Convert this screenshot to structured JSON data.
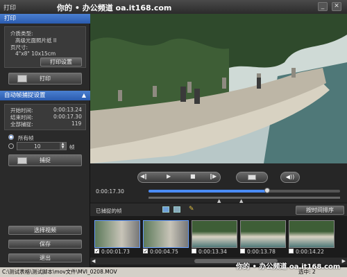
{
  "window": {
    "title": "打印",
    "watermark_top": "你的 • 办公频道 oa.it168.com"
  },
  "print_section": {
    "header": "打印",
    "media_type_label": "介质类型:",
    "media_type_value": "高级光面照片纸 II",
    "page_size_label": "页尺寸:",
    "page_size_value": "4\"x8\" 10x15cm",
    "settings_button": "打印设置",
    "print_button": "打印"
  },
  "capture_section": {
    "header": "自动帧捕捉设置",
    "start_label": "开始时间:",
    "start_value": "0:00:13.24",
    "end_label": "结束时间:",
    "end_value": "0:00:17.30",
    "total_label": "全部捕捉:",
    "total_value": "119",
    "all_frames_label": "所有帧",
    "interval_value": "10",
    "interval_unit": "帧",
    "capture_button": "捕捉"
  },
  "left_buttons": {
    "select_video": "选择视频",
    "save": "保存",
    "exit": "退出"
  },
  "player": {
    "current_time": "0:00:17.30",
    "progress": 0.62,
    "play_buttons": [
      "prev-frame",
      "play",
      "stop",
      "next-frame"
    ]
  },
  "captured": {
    "label": "已捕捉的帧",
    "sort_button": "按时间排序",
    "frames": [
      {
        "time": "0:00:01.73",
        "checked": true
      },
      {
        "time": "0:00:04.75",
        "checked": true
      },
      {
        "time": "0:00:13.34",
        "checked": false
      },
      {
        "time": "0:00:13.78",
        "checked": false
      },
      {
        "time": "0:00:14.22",
        "checked": false
      }
    ]
  },
  "status": {
    "path": "C:\\测试表格\\测试脚本\\mov文件\\MVI_0208.MOV",
    "selected": "选中: 2",
    "watermark_bottom": "你的 • 办公频道 oa.it168.com"
  },
  "colors": {
    "accent": "#2b5cb0",
    "progress": "#4a8cff"
  }
}
